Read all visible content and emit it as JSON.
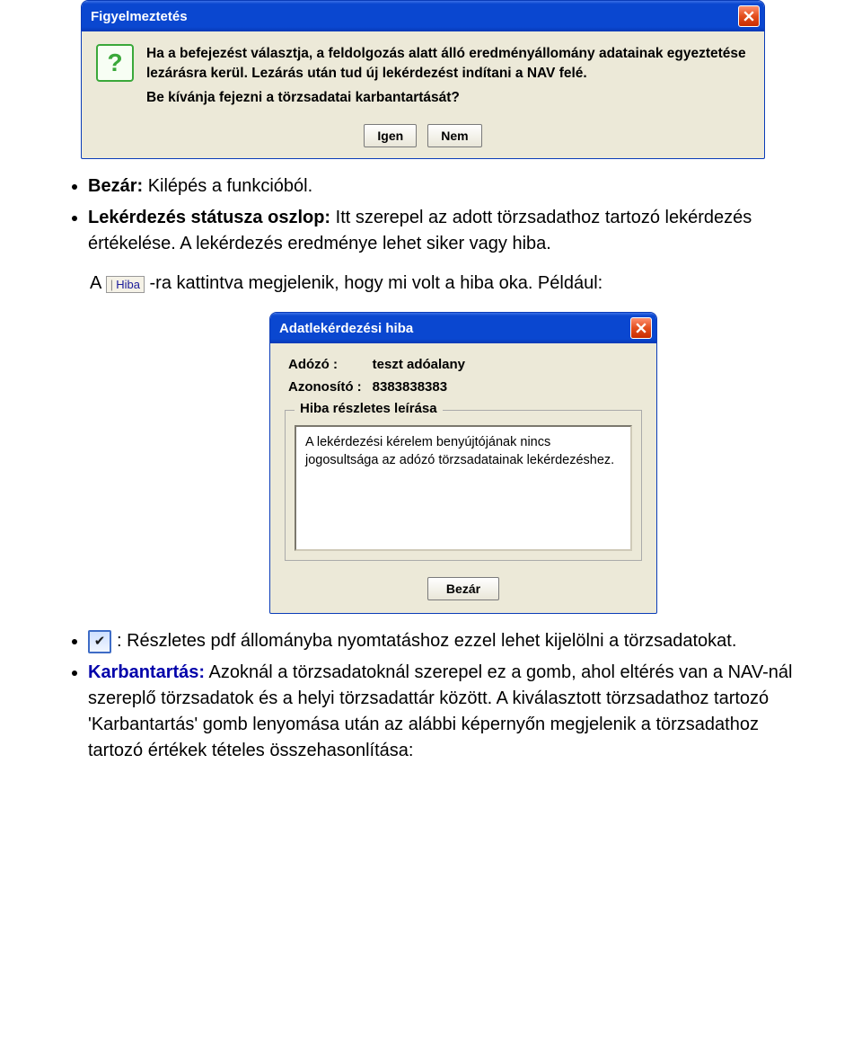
{
  "dialog1": {
    "title": "Figyelmeztetés",
    "message1": "Ha a befejezést választja, a feldolgozás alatt álló eredményállomány adatainak egyeztetése lezárásra kerül. Lezárás után tud új lekérdezést indítani a NAV felé.",
    "message2": "Be kívánja fejezni a törzsadatai karbantartását?",
    "btn_yes": "Igen",
    "btn_no": "Nem"
  },
  "bullets1": {
    "bezar_label": "Bezár:",
    "bezar_text": " Kilépés a funkcióból.",
    "lekerdezes_label": "Lekérdezés státusza oszlop:",
    "lekerdezes_text": " Itt szerepel az adott törzsadathoz tartozó lekérdezés értékelése. A lekérdezés eredménye lehet siker vagy hiba."
  },
  "hiba_line": {
    "prefix": "A ",
    "link_label": "Hiba",
    "mid": "-ra kattintva megjelenik, hogy mi volt a hiba oka. Például:"
  },
  "dialog2": {
    "title": "Adatlekérdezési hiba",
    "adozo_label": "Adózó :",
    "adozo_value": "teszt adóalany",
    "azon_label": "Azonosító :",
    "azon_value": "8383838383",
    "fieldset_legend": "Hiba részletes leírása",
    "error_text": "A lekérdezési kérelem benyújtójának nincs jogosultsága az adózó törzsadatainak lekérdezéshez.",
    "btn_close": "Bezár"
  },
  "bullets2": {
    "check_text": ": Részletes pdf állományba nyomtatáshoz ezzel lehet kijelölni a törzsadatokat.",
    "karb_label": "Karbantartás:",
    "karb_text": " Azoknál a törzsadatoknál szerepel ez a gomb, ahol eltérés van a NAV-nál szereplő törzsadatok és a helyi törzsadattár között. A kiválasztott törzsadathoz tartozó 'Karbantartás' gomb lenyomása után az alábbi képernyőn megjelenik a törzsadathoz tartozó értékek tételes összehasonlítása:"
  }
}
